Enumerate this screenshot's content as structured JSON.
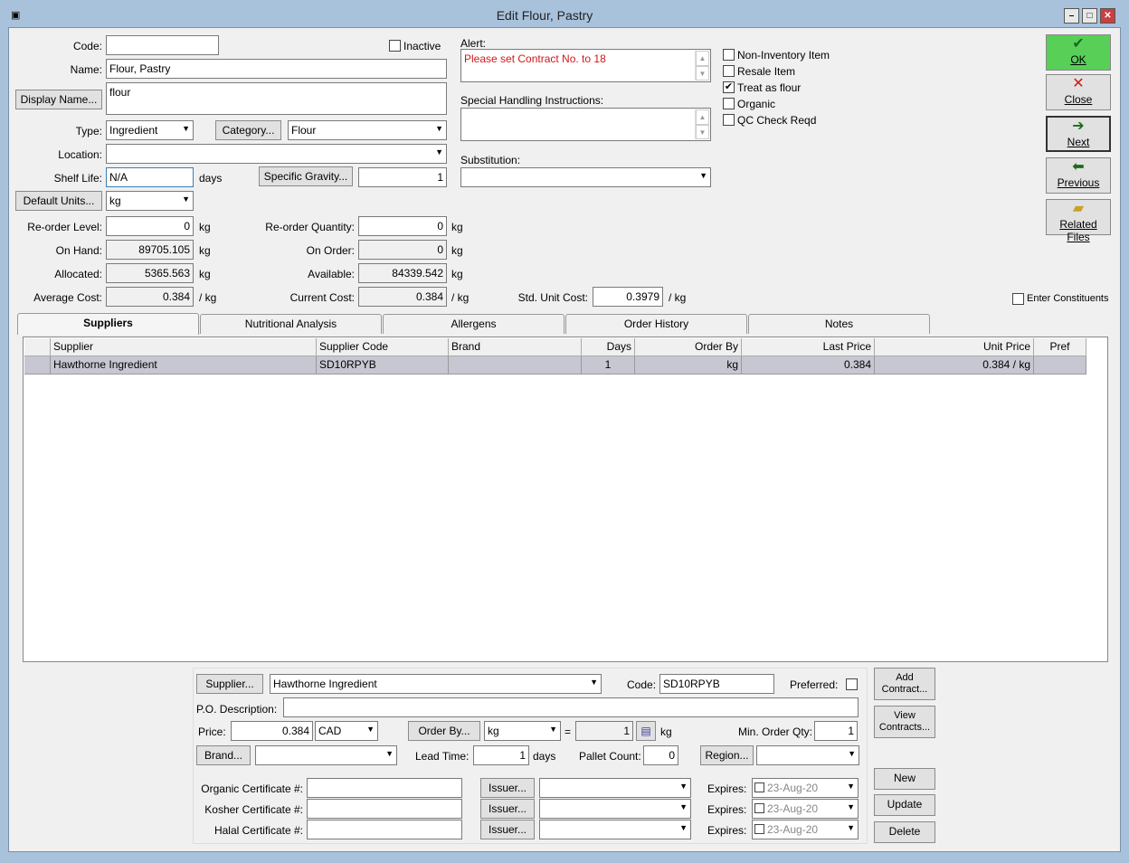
{
  "window": {
    "title": "Edit Flour, Pastry"
  },
  "form": {
    "code_label": "Code:",
    "code_value": "",
    "inactive_label": "Inactive",
    "name_label": "Name:",
    "name_value": "Flour, Pastry",
    "display_name_btn": "Display Name...",
    "display_name_value": "flour",
    "type_label": "Type:",
    "type_value": "Ingredient",
    "category_btn": "Category...",
    "category_value": "Flour",
    "location_label": "Location:",
    "location_value": "",
    "shelf_life_label": "Shelf Life:",
    "shelf_life_value": "N/A",
    "shelf_life_unit": "days",
    "specific_gravity_btn": "Specific Gravity...",
    "specific_gravity_value": "1",
    "default_units_btn": "Default Units...",
    "default_units_value": "kg",
    "reorder_level_label": "Re-order Level:",
    "reorder_level_value": "0",
    "reorder_level_unit": "kg",
    "reorder_qty_label": "Re-order Quantity:",
    "reorder_qty_value": "0",
    "reorder_qty_unit": "kg",
    "on_hand_label": "On Hand:",
    "on_hand_value": "89705.105",
    "on_hand_unit": "kg",
    "on_order_label": "On Order:",
    "on_order_value": "0",
    "on_order_unit": "kg",
    "allocated_label": "Allocated:",
    "allocated_value": "5365.563",
    "allocated_unit": "kg",
    "available_label": "Available:",
    "available_value": "84339.542",
    "available_unit": "kg",
    "avg_cost_label": "Average Cost:",
    "avg_cost_value": "0.384",
    "avg_cost_unit": "/ kg",
    "cur_cost_label": "Current Cost:",
    "cur_cost_value": "0.384",
    "cur_cost_unit": "/ kg",
    "std_cost_label": "Std. Unit Cost:",
    "std_cost_value": "0.3979",
    "std_cost_unit": "/ kg",
    "alert_label": "Alert:",
    "alert_value": "Please set Contract No. to 18",
    "special_label": "Special Handling Instructions:",
    "special_value": "",
    "substitution_label": "Substitution:",
    "substitution_value": "",
    "enter_constituents_label": "Enter Constituents"
  },
  "checkboxes": [
    {
      "label": "Non-Inventory Item",
      "checked": ""
    },
    {
      "label": "Resale Item",
      "checked": ""
    },
    {
      "label": "Treat as flour",
      "checked": "✔"
    },
    {
      "label": "Organic",
      "checked": ""
    },
    {
      "label": "QC Check Reqd",
      "checked": ""
    }
  ],
  "side_buttons": {
    "ok": "OK",
    "close": "Close",
    "next": "Next",
    "previous": "Previous",
    "related": "Related Files"
  },
  "tabs": [
    "Suppliers",
    "Nutritional Analysis",
    "Allergens",
    "Order History",
    "Notes"
  ],
  "grid": {
    "headers": [
      "Supplier",
      "Supplier Code",
      "Brand",
      "Days",
      "Order By",
      "Last Price",
      "Unit Price",
      "Pref"
    ],
    "rows": [
      [
        "Hawthorne Ingredient",
        "SD10RPYB",
        "",
        "1",
        "kg",
        "0.384",
        "0.384 / kg",
        ""
      ]
    ]
  },
  "detail": {
    "supplier_btn": "Supplier...",
    "supplier_value": "Hawthorne Ingredient",
    "code_label": "Code:",
    "code_value": "SD10RPYB",
    "preferred_label": "Preferred:",
    "po_desc_label": "P.O. Description:",
    "po_desc_value": "",
    "price_label": "Price:",
    "price_value": "0.384",
    "currency_value": "CAD",
    "order_by_btn": "Order By...",
    "order_by_value": "kg",
    "equals": "=",
    "conv_value": "1",
    "conv_unit": "kg",
    "min_order_label": "Min. Order Qty:",
    "min_order_value": "1",
    "brand_btn": "Brand...",
    "brand_value": "",
    "lead_time_label": "Lead Time:",
    "lead_time_value": "1",
    "lead_time_unit": "days",
    "pallet_label": "Pallet Count:",
    "pallet_value": "0",
    "region_btn": "Region...",
    "region_value": "",
    "organic_cert_label": "Organic Certificate #:",
    "kosher_cert_label": "Kosher Certificate #:",
    "halal_cert_label": "Halal Certificate #:",
    "issuer_btn": "Issuer...",
    "expires_label": "Expires:",
    "expires_value": "23-Aug-20",
    "add_contract_btn": "Add Contract...",
    "view_contracts_btn": "View Contracts...",
    "new_btn": "New",
    "update_btn": "Update",
    "delete_btn": "Delete"
  }
}
